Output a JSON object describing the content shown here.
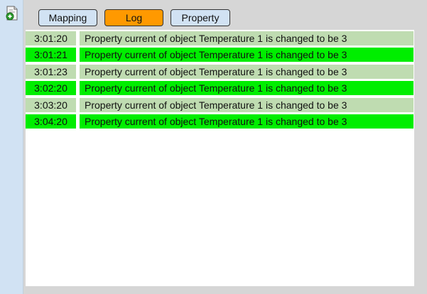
{
  "sidebar": {
    "add_icon": "add-document-icon"
  },
  "tabs": [
    {
      "label": "Mapping",
      "active": false
    },
    {
      "label": "Log",
      "active": true
    },
    {
      "label": "Property",
      "active": false
    }
  ],
  "log": {
    "rows": [
      {
        "time": "3:01:20",
        "message": "Property current of object Temperature 1 is changed to be 3",
        "style": "gray"
      },
      {
        "time": "3:01:21",
        "message": "Property current of object Temperature 1 is changed to be 3",
        "style": "green"
      },
      {
        "time": "3:01:23",
        "message": "Property current of object Temperature 1 is changed to be 3",
        "style": "gray"
      },
      {
        "time": "3:02:20",
        "message": "Property current of object Temperature 1 is changed to be 3",
        "style": "green"
      },
      {
        "time": "3:03:20",
        "message": "Property current of object Temperature 1 is changed to be 3",
        "style": "gray"
      },
      {
        "time": "3:04:20",
        "message": "Property current of object Temperature 1 is changed to be 3",
        "style": "green"
      }
    ]
  },
  "colors": {
    "active_tab": "#ff9900",
    "inactive_tab": "#d1e2f3",
    "row_gray": "#bfdcb1",
    "row_green": "#00ee00"
  }
}
